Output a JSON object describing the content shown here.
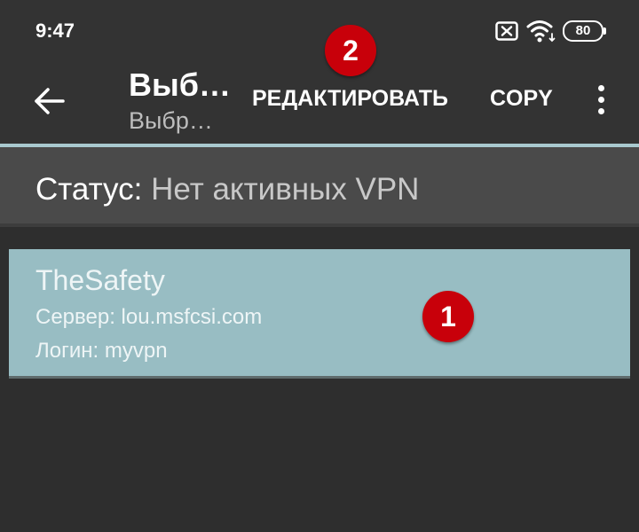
{
  "status_bar": {
    "time": "9:47",
    "battery_level": "80",
    "icons": [
      "sim-off-icon",
      "wifi-icon",
      "battery-icon"
    ]
  },
  "toolbar": {
    "title": "Выб…",
    "subtitle": "Выбр…",
    "back_icon": "arrow-left-icon",
    "edit_label": "РЕДАКТИРОВАТЬ",
    "copy_label": "COPY",
    "more_icon": "more-vertical-icon",
    "divider_color": "#a9c9cf"
  },
  "status_header": {
    "label": "Статус:",
    "value": "Нет активных VPN"
  },
  "profiles": [
    {
      "name": "TheSafety",
      "server": "Сервер: lou.msfcsi.com",
      "login": "Логин: myvpn",
      "background": "#98bdc3"
    }
  ],
  "annotations": [
    {
      "number": "1",
      "color": "#c8000a"
    },
    {
      "number": "2",
      "color": "#c8000a"
    }
  ]
}
